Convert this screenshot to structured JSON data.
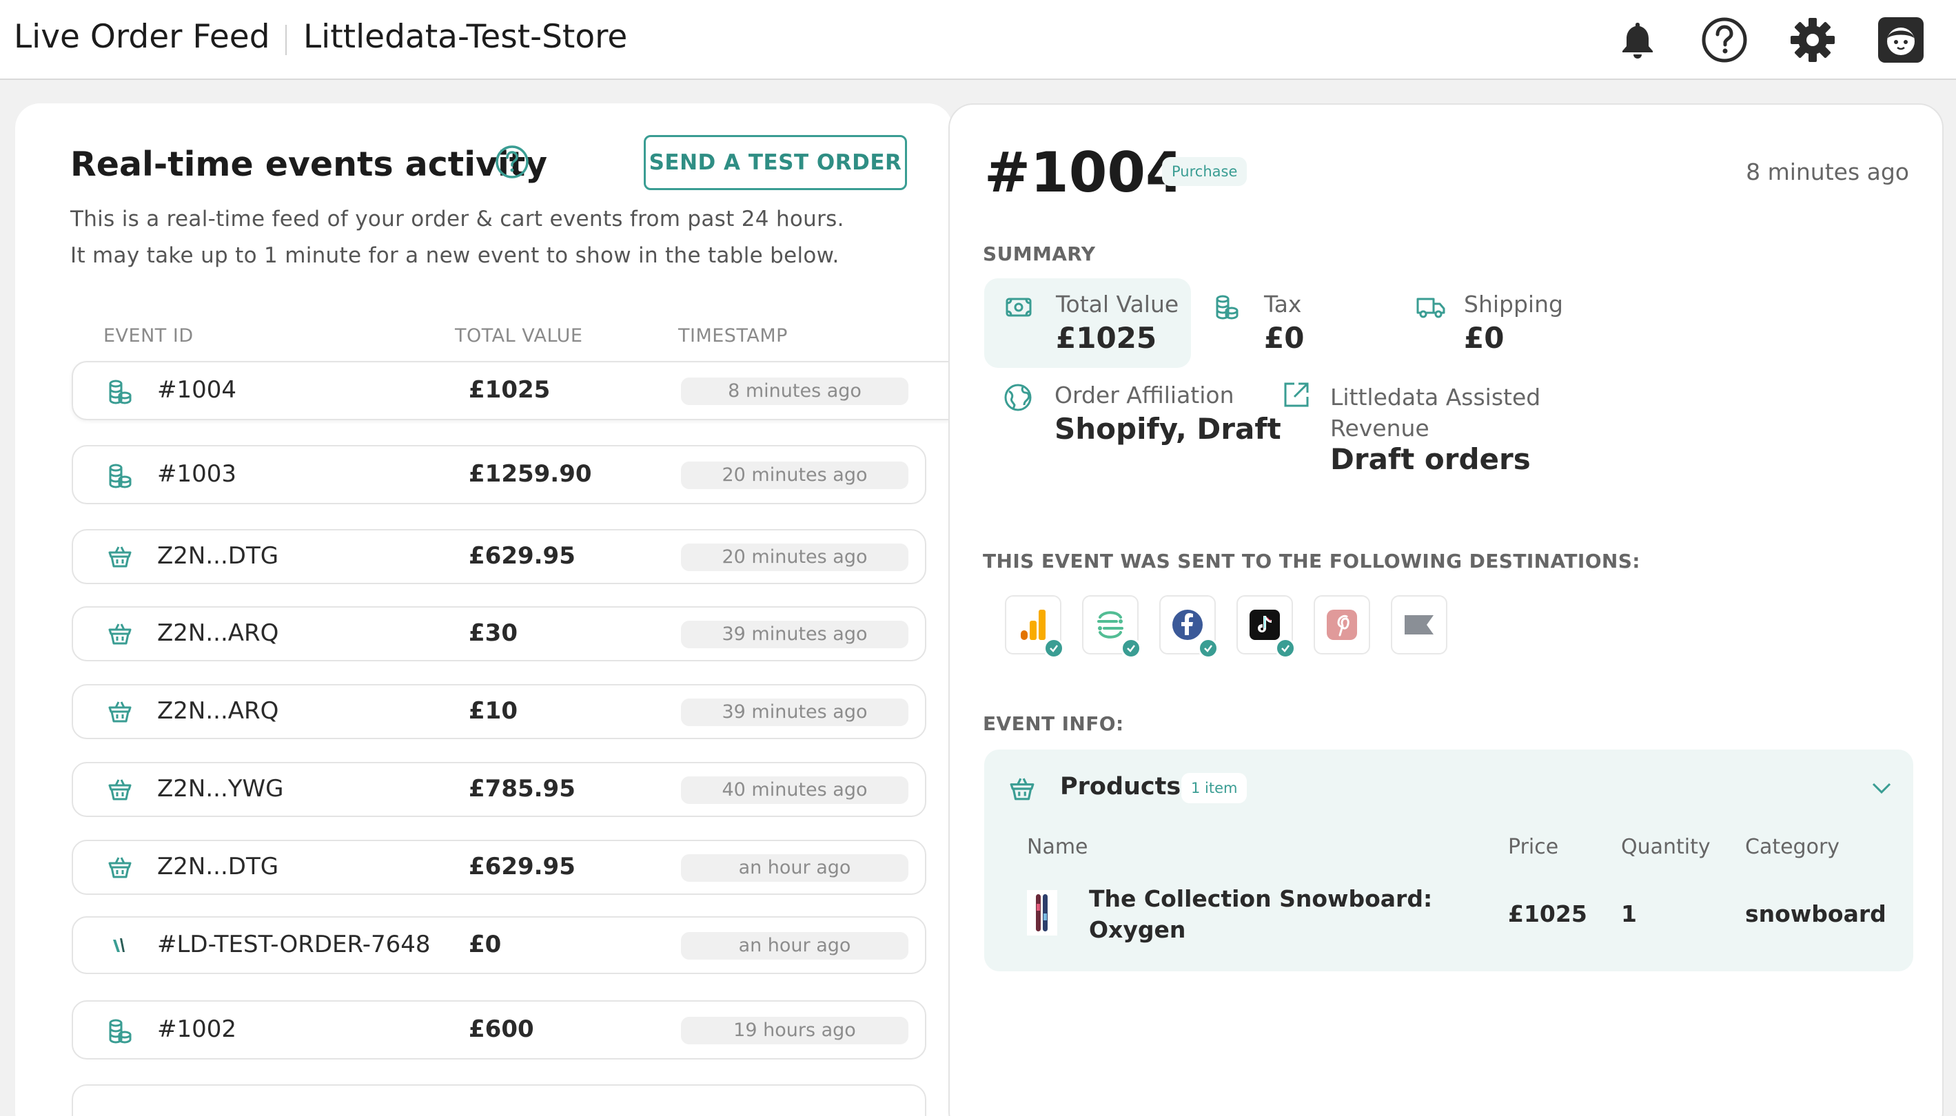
{
  "header": {
    "app_title": "Live Order Feed",
    "store_name": "Littledata-Test-Store",
    "icons": [
      "bell-icon",
      "help-icon",
      "gear-icon",
      "avatar-icon"
    ]
  },
  "feed": {
    "title": "Real-time events activity",
    "test_order_button": "SEND A TEST ORDER",
    "description_line1": "This is a real-time feed of your order & cart events from past 24 hours.",
    "description_line2": "It may take up to 1 minute for a new event to show in the table below.",
    "columns": {
      "event_id": "EVENT ID",
      "total_value": "TOTAL VALUE",
      "timestamp": "TIMESTAMP"
    },
    "rows": [
      {
        "icon": "coins-icon",
        "id": "#1004",
        "value": "£1025",
        "time": "8 minutes ago"
      },
      {
        "icon": "coins-icon",
        "id": "#1003",
        "value": "£1259.90",
        "time": "20 minutes ago"
      },
      {
        "icon": "basket-icon",
        "id": "Z2N...DTG",
        "value": "£629.95",
        "time": "20 minutes ago"
      },
      {
        "icon": "basket-icon",
        "id": "Z2N...ARQ",
        "value": "£30",
        "time": "39 minutes ago"
      },
      {
        "icon": "basket-icon",
        "id": "Z2N...ARQ",
        "value": "£10",
        "time": "39 minutes ago"
      },
      {
        "icon": "basket-icon",
        "id": "Z2N...YWG",
        "value": "£785.95",
        "time": "40 minutes ago"
      },
      {
        "icon": "basket-icon",
        "id": "Z2N...DTG",
        "value": "£629.95",
        "time": "an hour ago"
      },
      {
        "icon": "littledata-icon",
        "id": "#LD-TEST-ORDER-7648",
        "value": "£0",
        "time": "an hour ago"
      },
      {
        "icon": "coins-icon",
        "id": "#1002",
        "value": "£600",
        "time": "19 hours ago"
      }
    ]
  },
  "detail": {
    "order_id": "#1004",
    "event_type": "Purchase",
    "time": "8 minutes ago",
    "summary_label": "SUMMARY",
    "total_value_label": "Total Value",
    "total_value": "£1025",
    "tax_label": "Tax",
    "tax": "£0",
    "shipping_label": "Shipping",
    "shipping": "£0",
    "affiliation_label": "Order Affiliation",
    "affiliation": "Shopify, Draft",
    "assisted_label_line1": "Littledata Assisted",
    "assisted_label_line2": "Revenue",
    "assisted_value": "Draft orders",
    "destinations_label": "THIS EVENT WAS SENT TO THE FOLLOWING DESTINATIONS:",
    "destinations": [
      {
        "name": "google-analytics-icon",
        "sent": true
      },
      {
        "name": "segment-icon",
        "sent": true
      },
      {
        "name": "facebook-icon",
        "sent": true
      },
      {
        "name": "tiktok-icon",
        "sent": true
      },
      {
        "name": "pinterest-icon",
        "sent": false
      },
      {
        "name": "klaviyo-icon",
        "sent": false
      }
    ],
    "event_info_label": "EVENT INFO:",
    "products": {
      "title": "Products",
      "count": "1 item",
      "columns": {
        "name": "Name",
        "price": "Price",
        "quantity": "Quantity",
        "category": "Category"
      },
      "items": [
        {
          "name_line1": "The Collection Snowboard:",
          "name_line2": "Oxygen",
          "price": "£1025",
          "quantity": "1",
          "category": "snowboard"
        }
      ]
    }
  },
  "colors": {
    "accent": "#3a9d93",
    "accent_light": "#eef6f5"
  }
}
